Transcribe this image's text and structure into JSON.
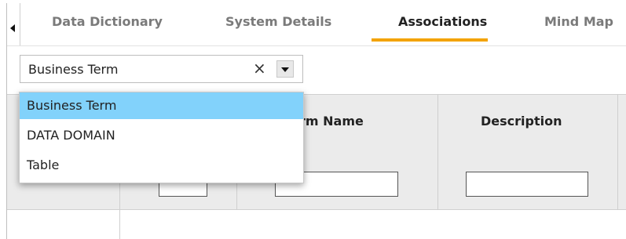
{
  "tabs": [
    {
      "label": "Data Dictionary",
      "active": false
    },
    {
      "label": "System Details",
      "active": false
    },
    {
      "label": "Associations",
      "active": true
    },
    {
      "label": "Mind Map",
      "active": false
    }
  ],
  "selector": {
    "value": "Business Term",
    "clear_glyph": "×",
    "dropdown_icon": "caret-down-icon"
  },
  "dropdown": {
    "options": [
      "Business Term",
      "DATA DOMAIN",
      "Table"
    ],
    "selected_index": 0
  },
  "grid": {
    "columns": [
      "Term Name",
      "Description"
    ],
    "visible_headers": [
      "rm Name",
      "Description"
    ]
  },
  "colors": {
    "active_tab_underline": "#f3a300",
    "selected_option": "#82d2fb",
    "header_bg": "#ebebeb"
  }
}
